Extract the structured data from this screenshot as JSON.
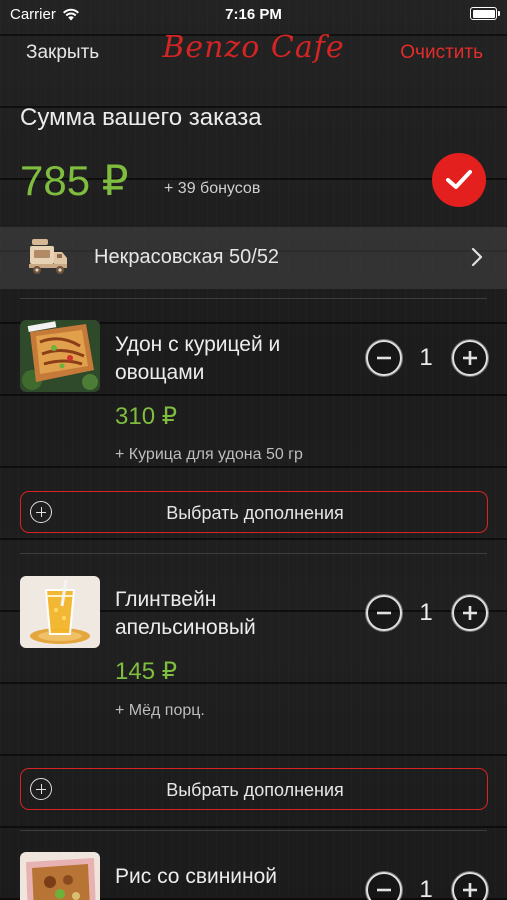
{
  "status_bar": {
    "carrier": "Carrier",
    "time": "7:16 PM",
    "wifi_icon": "wifi-icon",
    "battery_icon": "battery-icon"
  },
  "nav": {
    "close_label": "Закрыть",
    "logo_text": "Benzo Cafe",
    "clear_label": "Очистить"
  },
  "summary": {
    "title": "Сумма вашего заказа",
    "total": "785 ₽",
    "bonus": "+ 39 бонусов",
    "confirm_icon": "checkmark-icon"
  },
  "delivery": {
    "icon": "delivery-truck-icon",
    "address": "Некрасовская 50/52",
    "chevron_icon": "chevron-right-icon"
  },
  "items": [
    {
      "name": "Удон с курицей и овощами",
      "price": "310 ₽",
      "extra": "+ Курица для удона 50 гр",
      "quantity": "1",
      "addons_label": "Выбрать дополнения"
    },
    {
      "name": "Глинтвейн апельсиновый",
      "price": "145 ₽",
      "extra": "+ Мёд порц.",
      "quantity": "1",
      "addons_label": "Выбрать дополнения"
    },
    {
      "name": "Рис со свининой",
      "quantity": "1"
    }
  ],
  "colors": {
    "accent_red": "#e4201f",
    "price_green": "#7fbd3f",
    "background": "#1f1f1f"
  }
}
